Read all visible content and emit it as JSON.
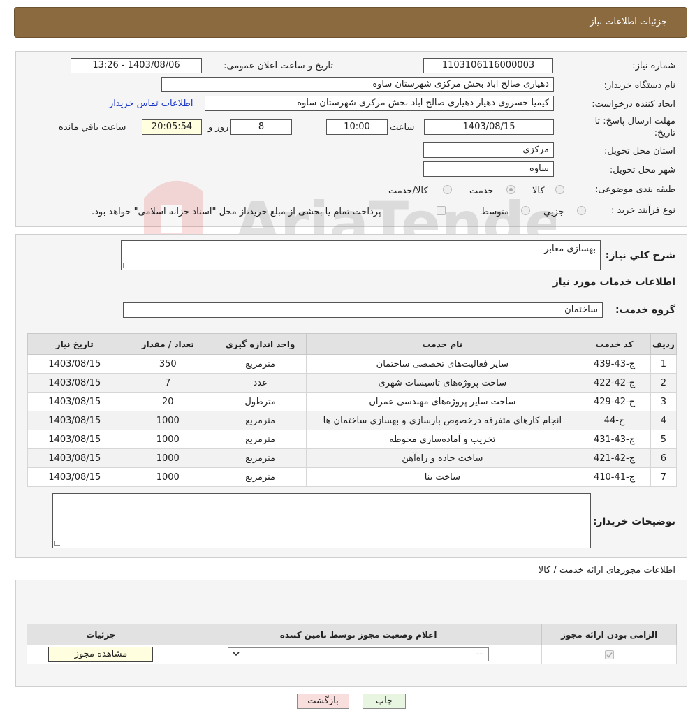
{
  "header": {
    "title": "جزئیات اطلاعات نیاز"
  },
  "fields": {
    "need_number_label": "شماره نیاز:",
    "need_number_value": "1103106116000003",
    "announce_label": "تاریخ و ساعت اعلان عمومی:",
    "announce_value": "1403/08/06 - 13:26",
    "buyer_label": "نام دستگاه خریدار:",
    "buyer_value": "دهیاری صالح اباد  بخش مرکزی شهرستان ساوه",
    "creator_label": "ایجاد کننده درخواست:",
    "creator_value": "کیمیا خسروی دهیار دهیاری صالح اباد  بخش مرکزی شهرستان ساوه",
    "contact_link": "اطلاعات تماس خریدار",
    "deadline_label_1": "مهلت ارسال پاسخ: تا",
    "deadline_label_2": "تاریخ:",
    "deadline_date": "1403/08/15",
    "hour_label": "ساعت",
    "deadline_hour": "10:00",
    "days_value": "8",
    "days_label": "روز و",
    "remaining_value": "20:05:54",
    "remaining_label": "ساعت باقي مانده",
    "province_label": "استان محل تحویل:",
    "province_value": "مرکزی",
    "city_label": "شهر محل تحویل:",
    "city_value": "ساوه",
    "category_label": "طبقه بندی موضوعی:",
    "category_options": [
      "کالا",
      "خدمت",
      "کالا/خدمت"
    ],
    "category_selected": "خدمت",
    "process_label": "نوع فرآیند خرید :",
    "process_options": [
      "جزیي",
      "متوسط"
    ],
    "process_note": "پرداخت تمام یا بخشی از مبلغ خرید،از محل \"اسناد خزانه اسلامی\" خواهد بود."
  },
  "description": {
    "label": "شرح کلي نياز:",
    "value": "بهسازی معابر"
  },
  "services": {
    "section_title": "اطلاعات خدمات مورد نیاز",
    "group_label": "گروه خدمت:",
    "group_value": "ساختمان",
    "columns": [
      "ردیف",
      "کد خدمت",
      "نام خدمت",
      "واحد اندازه گیری",
      "تعداد / مقدار",
      "تاریخ نیاز"
    ],
    "rows": [
      [
        "1",
        "ج-43-439",
        "سایر فعالیت‌های تخصصی ساختمان",
        "مترمربع",
        "350",
        "1403/08/15"
      ],
      [
        "2",
        "ج-42-422",
        "ساخت پروژه‌های تاسیسات شهری",
        "عدد",
        "7",
        "1403/08/15"
      ],
      [
        "3",
        "ج-42-429",
        "ساخت سایر پروژه‌های مهندسی عمران",
        "مترطول",
        "20",
        "1403/08/15"
      ],
      [
        "4",
        "ج-44",
        "انجام کارهای متفرقه درخصوص بازسازی و بهسازی ساختمان ها",
        "مترمربع",
        "1000",
        "1403/08/15"
      ],
      [
        "5",
        "ج-43-431",
        "تخریب و آماده‌سازی محوطه",
        "مترمربع",
        "1000",
        "1403/08/15"
      ],
      [
        "6",
        "ج-42-421",
        "ساخت جاده و راه‌آهن",
        "مترمربع",
        "1000",
        "1403/08/15"
      ],
      [
        "7",
        "ج-41-410",
        "ساخت بنا",
        "مترمربع",
        "1000",
        "1403/08/15"
      ]
    ]
  },
  "buyer_notes": {
    "label": "توضیحات خریدار:",
    "value": ""
  },
  "permits": {
    "title": "اطلاعات مجوزهای ارائه خدمت / کالا",
    "columns": [
      "الزامی بودن ارائه مجوز",
      "اعلام وضعیت مجوز توسط تامین کننده",
      "جزئیات"
    ],
    "select_value": "--",
    "view_button": "مشاهده مجوز"
  },
  "actions": {
    "print": "چاپ",
    "back": "بازگشت"
  },
  "colors": {
    "header_bg": "#8b6a3f",
    "link": "#1a35c8",
    "print_bg": "#e8f5e0",
    "back_bg": "#f9dede"
  }
}
